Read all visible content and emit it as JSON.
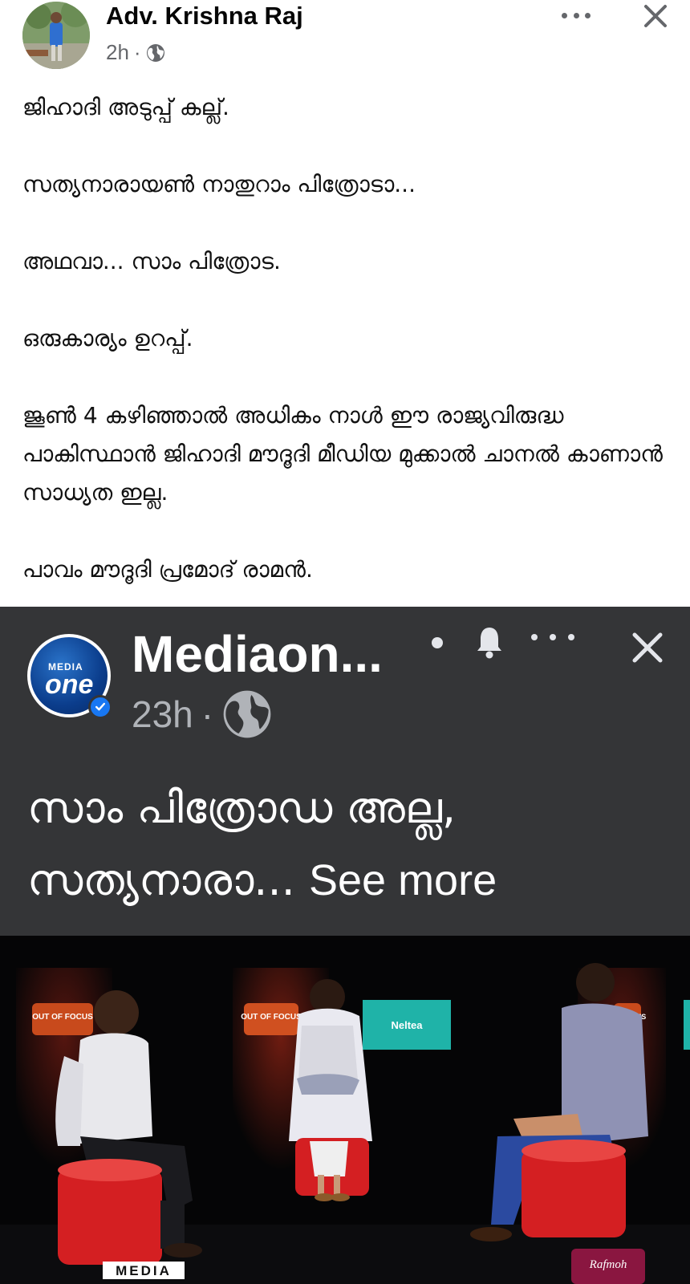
{
  "post": {
    "author": "Adv. Krishna Raj",
    "time": "2h",
    "separator": "·",
    "privacy_icon": "globe-icon",
    "paragraphs": [
      "ജിഹാദി അടുപ്പ് കല്ല്.",
      "സത്യനാരായൺ   നാതുറാം പിത്രോടാ...",
      "അഥവാ... സാം പിത്രോട.",
      "ഒരുകാര്യം ഉറപ്പ്.",
      "ജൂൺ 4 കഴിഞ്ഞാൽ അധികം നാൾ ഈ രാജ്യവിരുദ്ധ പാകിസ്ഥാൻ ജിഹാദി മൗദൂദി മീഡിയ മുക്കാൽ ചാനൽ കാണാൻ സാധ്യത ഇല്ല.",
      "പാവം മൗദൂദി പ്രമോദ് രാമൻ."
    ]
  },
  "shared": {
    "page_name": "Mediaon...",
    "time": "23h",
    "separator": "·",
    "text": "സാം പിത്രോഡ അല്ല, സത്യനാരാ...",
    "see_more": "See more",
    "logo_top": "MEDIA",
    "logo_main": "one",
    "colors": {
      "background": "#343537",
      "text": "#ffffff",
      "meta": "#b0b3b8",
      "verified": "#1877f2"
    }
  },
  "video": {
    "set_sign_left": "OUT OF FOCUS",
    "set_sign_center": "OUT OF FOCUS",
    "set_sign_right": "OF FOCUS",
    "screen_label": "Neltea",
    "watermark_top": "MEDIA",
    "sponsor": "Rafmoh"
  }
}
